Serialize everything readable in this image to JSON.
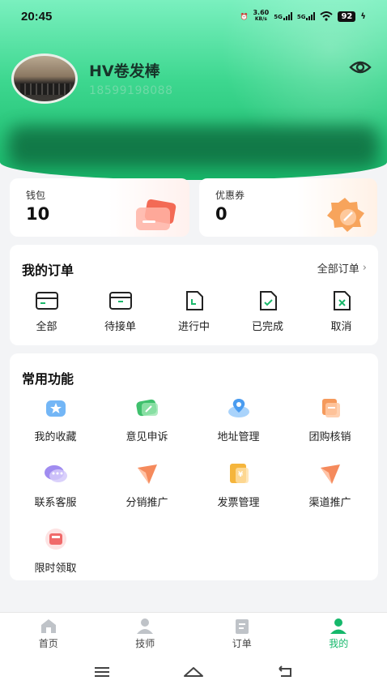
{
  "status_bar": {
    "time": "20:45",
    "net_speed": "3.60",
    "net_unit": "KB/s",
    "sig1": "5G",
    "sig2": "5G",
    "battery": "92"
  },
  "profile": {
    "name": "HV卷发棒",
    "phone": "18599198088"
  },
  "wallet": {
    "label": "钱包",
    "value": "10"
  },
  "coupon": {
    "label": "优惠券",
    "value": "0"
  },
  "orders": {
    "title": "我的订单",
    "all_label": "全部订单",
    "items": [
      {
        "label": "全部",
        "icon": "card-icon"
      },
      {
        "label": "待接单",
        "icon": "inbox-icon"
      },
      {
        "label": "进行中",
        "icon": "file-progress-icon"
      },
      {
        "label": "已完成",
        "icon": "file-check-icon"
      },
      {
        "label": "取消",
        "icon": "file-cancel-icon"
      }
    ]
  },
  "functions": {
    "title": "常用功能",
    "items": [
      {
        "label": "我的收藏",
        "icon": "star-icon",
        "color": "#5aa9f5"
      },
      {
        "label": "意见申诉",
        "icon": "feedback-icon",
        "color": "#3fc06d"
      },
      {
        "label": "地址管理",
        "icon": "location-icon",
        "color": "#4a9cf0"
      },
      {
        "label": "团购核销",
        "icon": "coupon-icon",
        "color": "#f59a5c"
      },
      {
        "label": "联系客服",
        "icon": "chat-icon",
        "color": "#a08cf0"
      },
      {
        "label": "分销推广",
        "icon": "send-icon",
        "color": "#f58a5c"
      },
      {
        "label": "发票管理",
        "icon": "invoice-icon",
        "color": "#f5b53c"
      },
      {
        "label": "渠道推广",
        "icon": "send-icon",
        "color": "#f58a5c"
      },
      {
        "label": "限时领取",
        "icon": "gift-icon",
        "color": "#f06a6a"
      }
    ]
  },
  "tabbar": [
    {
      "label": "首页",
      "icon": "home-icon"
    },
    {
      "label": "技师",
      "icon": "person-icon"
    },
    {
      "label": "订单",
      "icon": "clipboard-icon"
    },
    {
      "label": "我的",
      "icon": "user-icon",
      "active": true
    }
  ],
  "colors": {
    "accent": "#15b86b",
    "hero_top": "#7af0bf",
    "hero_bottom": "#18b86a"
  }
}
